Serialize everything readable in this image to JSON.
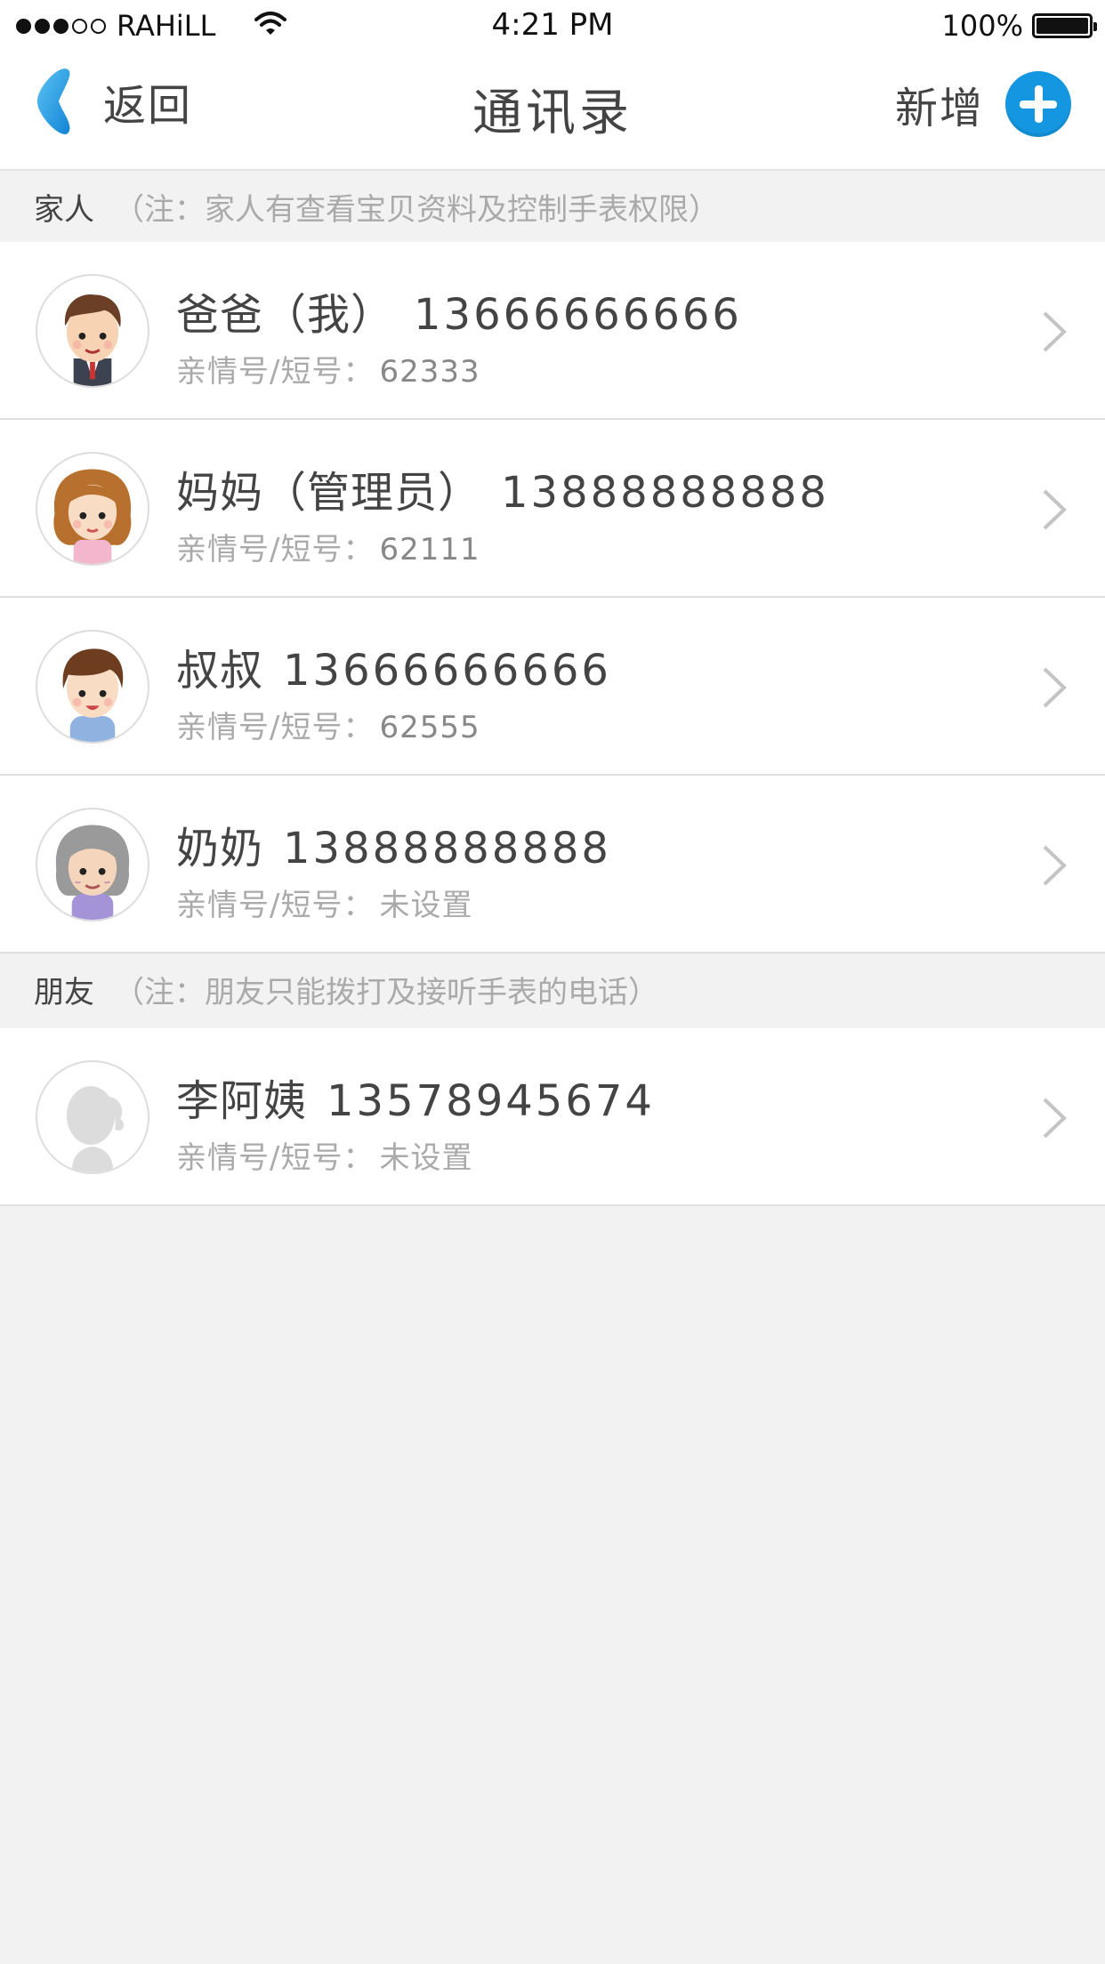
{
  "status_bar": {
    "carrier": "RAHiLL",
    "time": "4:21 PM",
    "battery": "100%",
    "signal_strength": 3
  },
  "nav": {
    "back_label": "返回",
    "title": "通讯录",
    "add_label": "新增"
  },
  "sections": [
    {
      "name": "家人",
      "note": "（注：家人有查看宝贝资料及控制手表权限）",
      "contacts": [
        {
          "name": "爸爸（我）",
          "phone": "13666666666",
          "short_label": "亲情号/短号：",
          "short_number": "62333",
          "avatar": "dad-avatar"
        },
        {
          "name": "妈妈（管理员）",
          "phone": "13888888888",
          "short_label": "亲情号/短号：",
          "short_number": "62111",
          "avatar": "mom-avatar"
        },
        {
          "name": "叔叔",
          "phone": "13666666666",
          "short_label": "亲情号/短号：",
          "short_number": "62555",
          "avatar": "uncle-avatar"
        },
        {
          "name": "奶奶",
          "phone": "13888888888",
          "short_label": "亲情号/短号：",
          "short_number": "未设置",
          "avatar": "grandma-avatar"
        }
      ]
    },
    {
      "name": "朋友",
      "note": "（注：朋友只能拨打及接听手表的电话）",
      "contacts": [
        {
          "name": "李阿姨",
          "phone": "13578945674",
          "short_label": "亲情号/短号：",
          "short_number": "未设置",
          "avatar": "placeholder-avatar"
        }
      ]
    }
  ],
  "colors": {
    "accent_blue": "#1497e0",
    "text_dark": "#444444",
    "text_gray": "#aaaaaa",
    "background": "#f2f2f2"
  }
}
